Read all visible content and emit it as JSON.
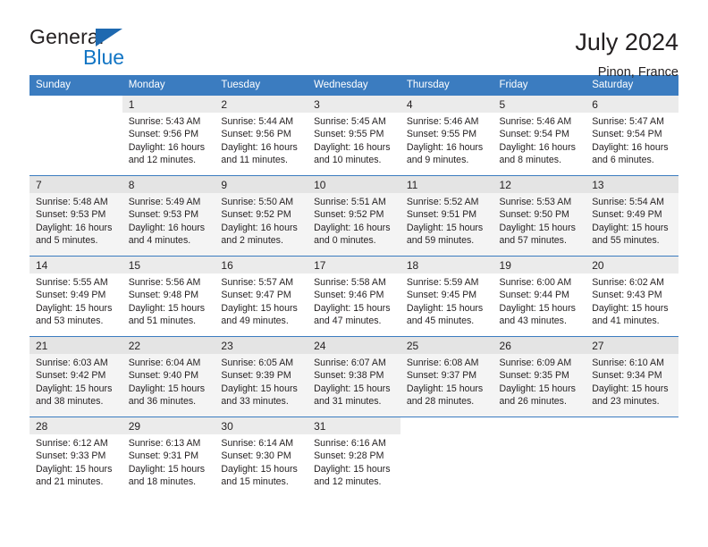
{
  "brand": {
    "word_one": "General",
    "word_two": "Blue",
    "logo_icon": "triangle-logo-icon",
    "accent_color": "#1275c4"
  },
  "header": {
    "title": "July 2024",
    "location": "Pinon, France"
  },
  "calendar": {
    "header_bg": "#3b7cc0",
    "weekday_headers": [
      "Sunday",
      "Monday",
      "Tuesday",
      "Wednesday",
      "Thursday",
      "Friday",
      "Saturday"
    ],
    "weeks": [
      [
        {
          "day": "",
          "sunrise": "",
          "sunset": "",
          "daylight_line1": "",
          "daylight_line2": ""
        },
        {
          "day": "1",
          "sunrise": "Sunrise: 5:43 AM",
          "sunset": "Sunset: 9:56 PM",
          "daylight_line1": "Daylight: 16 hours",
          "daylight_line2": "and 12 minutes."
        },
        {
          "day": "2",
          "sunrise": "Sunrise: 5:44 AM",
          "sunset": "Sunset: 9:56 PM",
          "daylight_line1": "Daylight: 16 hours",
          "daylight_line2": "and 11 minutes."
        },
        {
          "day": "3",
          "sunrise": "Sunrise: 5:45 AM",
          "sunset": "Sunset: 9:55 PM",
          "daylight_line1": "Daylight: 16 hours",
          "daylight_line2": "and 10 minutes."
        },
        {
          "day": "4",
          "sunrise": "Sunrise: 5:46 AM",
          "sunset": "Sunset: 9:55 PM",
          "daylight_line1": "Daylight: 16 hours",
          "daylight_line2": "and 9 minutes."
        },
        {
          "day": "5",
          "sunrise": "Sunrise: 5:46 AM",
          "sunset": "Sunset: 9:54 PM",
          "daylight_line1": "Daylight: 16 hours",
          "daylight_line2": "and 8 minutes."
        },
        {
          "day": "6",
          "sunrise": "Sunrise: 5:47 AM",
          "sunset": "Sunset: 9:54 PM",
          "daylight_line1": "Daylight: 16 hours",
          "daylight_line2": "and 6 minutes."
        }
      ],
      [
        {
          "day": "7",
          "sunrise": "Sunrise: 5:48 AM",
          "sunset": "Sunset: 9:53 PM",
          "daylight_line1": "Daylight: 16 hours",
          "daylight_line2": "and 5 minutes."
        },
        {
          "day": "8",
          "sunrise": "Sunrise: 5:49 AM",
          "sunset": "Sunset: 9:53 PM",
          "daylight_line1": "Daylight: 16 hours",
          "daylight_line2": "and 4 minutes."
        },
        {
          "day": "9",
          "sunrise": "Sunrise: 5:50 AM",
          "sunset": "Sunset: 9:52 PM",
          "daylight_line1": "Daylight: 16 hours",
          "daylight_line2": "and 2 minutes."
        },
        {
          "day": "10",
          "sunrise": "Sunrise: 5:51 AM",
          "sunset": "Sunset: 9:52 PM",
          "daylight_line1": "Daylight: 16 hours",
          "daylight_line2": "and 0 minutes."
        },
        {
          "day": "11",
          "sunrise": "Sunrise: 5:52 AM",
          "sunset": "Sunset: 9:51 PM",
          "daylight_line1": "Daylight: 15 hours",
          "daylight_line2": "and 59 minutes."
        },
        {
          "day": "12",
          "sunrise": "Sunrise: 5:53 AM",
          "sunset": "Sunset: 9:50 PM",
          "daylight_line1": "Daylight: 15 hours",
          "daylight_line2": "and 57 minutes."
        },
        {
          "day": "13",
          "sunrise": "Sunrise: 5:54 AM",
          "sunset": "Sunset: 9:49 PM",
          "daylight_line1": "Daylight: 15 hours",
          "daylight_line2": "and 55 minutes."
        }
      ],
      [
        {
          "day": "14",
          "sunrise": "Sunrise: 5:55 AM",
          "sunset": "Sunset: 9:49 PM",
          "daylight_line1": "Daylight: 15 hours",
          "daylight_line2": "and 53 minutes."
        },
        {
          "day": "15",
          "sunrise": "Sunrise: 5:56 AM",
          "sunset": "Sunset: 9:48 PM",
          "daylight_line1": "Daylight: 15 hours",
          "daylight_line2": "and 51 minutes."
        },
        {
          "day": "16",
          "sunrise": "Sunrise: 5:57 AM",
          "sunset": "Sunset: 9:47 PM",
          "daylight_line1": "Daylight: 15 hours",
          "daylight_line2": "and 49 minutes."
        },
        {
          "day": "17",
          "sunrise": "Sunrise: 5:58 AM",
          "sunset": "Sunset: 9:46 PM",
          "daylight_line1": "Daylight: 15 hours",
          "daylight_line2": "and 47 minutes."
        },
        {
          "day": "18",
          "sunrise": "Sunrise: 5:59 AM",
          "sunset": "Sunset: 9:45 PM",
          "daylight_line1": "Daylight: 15 hours",
          "daylight_line2": "and 45 minutes."
        },
        {
          "day": "19",
          "sunrise": "Sunrise: 6:00 AM",
          "sunset": "Sunset: 9:44 PM",
          "daylight_line1": "Daylight: 15 hours",
          "daylight_line2": "and 43 minutes."
        },
        {
          "day": "20",
          "sunrise": "Sunrise: 6:02 AM",
          "sunset": "Sunset: 9:43 PM",
          "daylight_line1": "Daylight: 15 hours",
          "daylight_line2": "and 41 minutes."
        }
      ],
      [
        {
          "day": "21",
          "sunrise": "Sunrise: 6:03 AM",
          "sunset": "Sunset: 9:42 PM",
          "daylight_line1": "Daylight: 15 hours",
          "daylight_line2": "and 38 minutes."
        },
        {
          "day": "22",
          "sunrise": "Sunrise: 6:04 AM",
          "sunset": "Sunset: 9:40 PM",
          "daylight_line1": "Daylight: 15 hours",
          "daylight_line2": "and 36 minutes."
        },
        {
          "day": "23",
          "sunrise": "Sunrise: 6:05 AM",
          "sunset": "Sunset: 9:39 PM",
          "daylight_line1": "Daylight: 15 hours",
          "daylight_line2": "and 33 minutes."
        },
        {
          "day": "24",
          "sunrise": "Sunrise: 6:07 AM",
          "sunset": "Sunset: 9:38 PM",
          "daylight_line1": "Daylight: 15 hours",
          "daylight_line2": "and 31 minutes."
        },
        {
          "day": "25",
          "sunrise": "Sunrise: 6:08 AM",
          "sunset": "Sunset: 9:37 PM",
          "daylight_line1": "Daylight: 15 hours",
          "daylight_line2": "and 28 minutes."
        },
        {
          "day": "26",
          "sunrise": "Sunrise: 6:09 AM",
          "sunset": "Sunset: 9:35 PM",
          "daylight_line1": "Daylight: 15 hours",
          "daylight_line2": "and 26 minutes."
        },
        {
          "day": "27",
          "sunrise": "Sunrise: 6:10 AM",
          "sunset": "Sunset: 9:34 PM",
          "daylight_line1": "Daylight: 15 hours",
          "daylight_line2": "and 23 minutes."
        }
      ],
      [
        {
          "day": "28",
          "sunrise": "Sunrise: 6:12 AM",
          "sunset": "Sunset: 9:33 PM",
          "daylight_line1": "Daylight: 15 hours",
          "daylight_line2": "and 21 minutes."
        },
        {
          "day": "29",
          "sunrise": "Sunrise: 6:13 AM",
          "sunset": "Sunset: 9:31 PM",
          "daylight_line1": "Daylight: 15 hours",
          "daylight_line2": "and 18 minutes."
        },
        {
          "day": "30",
          "sunrise": "Sunrise: 6:14 AM",
          "sunset": "Sunset: 9:30 PM",
          "daylight_line1": "Daylight: 15 hours",
          "daylight_line2": "and 15 minutes."
        },
        {
          "day": "31",
          "sunrise": "Sunrise: 6:16 AM",
          "sunset": "Sunset: 9:28 PM",
          "daylight_line1": "Daylight: 15 hours",
          "daylight_line2": "and 12 minutes."
        },
        {
          "day": "",
          "sunrise": "",
          "sunset": "",
          "daylight_line1": "",
          "daylight_line2": ""
        },
        {
          "day": "",
          "sunrise": "",
          "sunset": "",
          "daylight_line1": "",
          "daylight_line2": ""
        },
        {
          "day": "",
          "sunrise": "",
          "sunset": "",
          "daylight_line1": "",
          "daylight_line2": ""
        }
      ]
    ]
  }
}
